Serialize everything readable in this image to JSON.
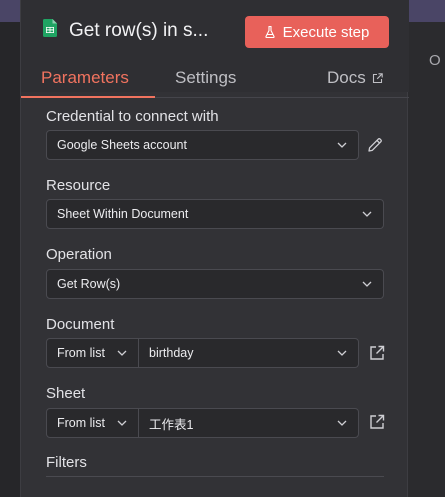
{
  "node": {
    "title": "Get row(s) in s...",
    "execute_label": "Execute step",
    "icon": "google-sheets-icon",
    "accent": "#e8615a"
  },
  "tabs": {
    "parameters": "Parameters",
    "settings": "Settings",
    "docs": "Docs"
  },
  "background": {
    "right_letter": "O"
  },
  "fields": {
    "credential": {
      "label": "Credential to connect with",
      "value": "Google Sheets account"
    },
    "resource": {
      "label": "Resource",
      "value": "Sheet Within Document"
    },
    "operation": {
      "label": "Operation",
      "value": "Get Row(s)"
    },
    "document": {
      "label": "Document",
      "mode": "From list",
      "value": "birthday"
    },
    "sheet": {
      "label": "Sheet",
      "mode": "From list",
      "value": "工作表1"
    },
    "filters": {
      "label": "Filters"
    }
  }
}
